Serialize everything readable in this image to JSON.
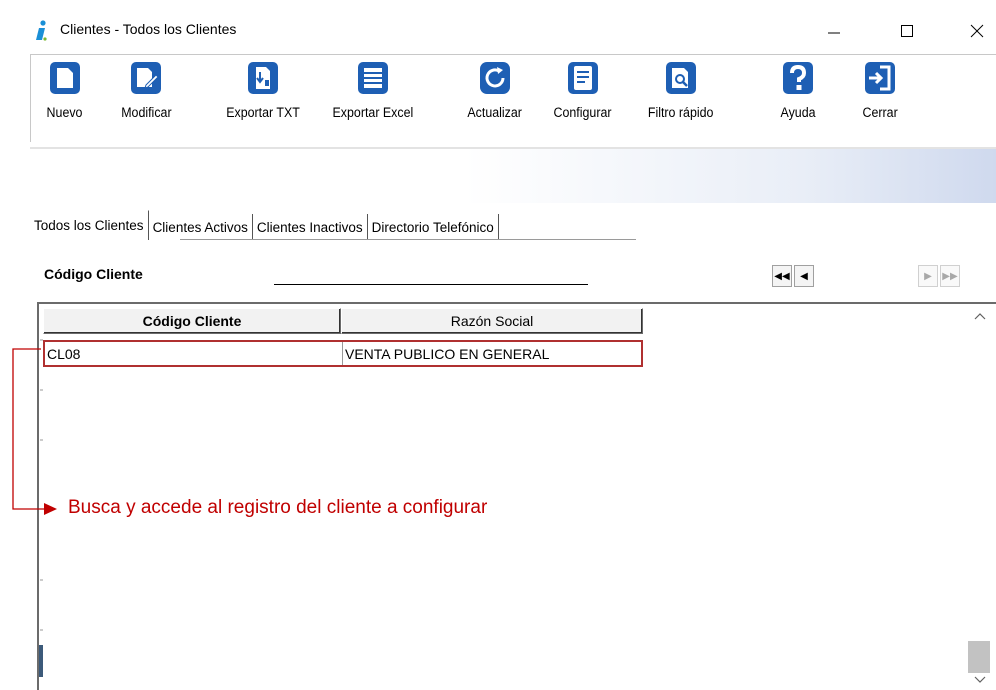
{
  "window": {
    "title": "Clientes - Todos los Clientes"
  },
  "toolbar": {
    "buttons": [
      {
        "label": "Nuevo",
        "icon": "new-document-icon"
      },
      {
        "label": "Modificar",
        "icon": "edit-document-icon"
      },
      {
        "label": "Exportar TXT",
        "icon": "export-txt-icon"
      },
      {
        "label": "Exportar Excel",
        "icon": "export-excel-icon"
      },
      {
        "label": "Actualizar",
        "icon": "refresh-icon"
      },
      {
        "label": "Configurar",
        "icon": "configure-icon"
      },
      {
        "label": "Filtro rápido",
        "icon": "quick-filter-icon"
      },
      {
        "label": "Ayuda",
        "icon": "help-icon"
      },
      {
        "label": "Cerrar",
        "icon": "close-door-icon"
      }
    ]
  },
  "tabs": [
    {
      "label": "Todos los Clientes",
      "active": true
    },
    {
      "label": "Clientes Activos",
      "active": false
    },
    {
      "label": "Clientes Inactivos",
      "active": false
    },
    {
      "label": "Directorio Telefónico",
      "active": false
    }
  ],
  "search": {
    "label": "Código Cliente",
    "value": ""
  },
  "grid": {
    "columns": [
      "Código Cliente",
      "Razón Social"
    ],
    "rows": [
      [
        "CL08",
        "VENTA PUBLICO EN GENERAL"
      ]
    ]
  },
  "annotation": {
    "text": "Busca y accede al registro del cliente a configurar",
    "color": "#c00000"
  },
  "colors": {
    "icon_blue": "#1e5fb4",
    "highlight_red": "#b03030"
  }
}
